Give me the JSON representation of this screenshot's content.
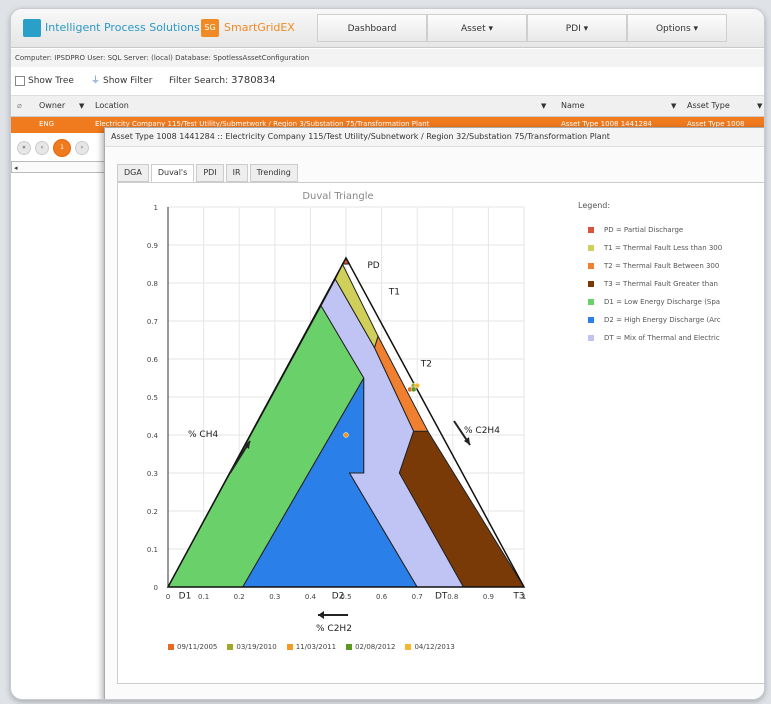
{
  "app": {
    "brand": "Intelligent Process Solutions",
    "product_badge": "SG",
    "product": "SmartGridEX"
  },
  "nav": [
    {
      "label": "Dashboard",
      "w": 110
    },
    {
      "label": "Asset ▾",
      "w": 100
    },
    {
      "label": "PDI ▾",
      "w": 100
    },
    {
      "label": "Options ▾",
      "w": 100
    }
  ],
  "crumb": "Computer: IPSDPRO  User: SQL  Server: (local)  Database: SpotlessAssetConfiguration",
  "toolbar": {
    "show_tree": "Show Tree",
    "show_filter": "Show Filter",
    "filter_search_label": "Filter Search:",
    "filter_search_value": "3780834"
  },
  "grid": {
    "columns": [
      "Owner",
      "Location",
      "Name",
      "Asset Type"
    ],
    "selected_row": [
      "ENG",
      "Electricity Company 115/Test Utility/Submetwork / Region 3/Substation 75/Transformation Plant",
      "Asset Type 1008 1441284",
      "Asset Type 1008"
    ]
  },
  "pager": {
    "current": "1"
  },
  "dialog": {
    "title": "Asset Type 1008 1441284 :: Electricity Company 115/Test Utility/Subnetwork / Region 32/Substation 75/Transformation Plant",
    "tabs": [
      "DGA",
      "Duval's",
      "PDI",
      "IR",
      "Trending"
    ],
    "active_tab": "Duval's"
  },
  "chart_data": {
    "type": "scatter",
    "title": "Duval Triangle",
    "yticks": [
      "0",
      "0.1",
      "0.2",
      "0.3",
      "0.4",
      "0.5",
      "0.6",
      "0.7",
      "0.8",
      "0.9",
      "1"
    ],
    "xticks": [
      "0",
      "0.1",
      "0.2",
      "0.3",
      "0.4",
      "0.5",
      "0.6",
      "0.7",
      "0.8",
      "0.9",
      "1"
    ],
    "zone_labels": [
      "PD",
      "T1",
      "T2",
      "D1",
      "D2",
      "DT",
      "T3"
    ],
    "axis_labels": {
      "left": "% CH4",
      "right": "% C2H4",
      "bottom": "% C2H2"
    },
    "legend_title": "Legend:",
    "legend": [
      {
        "label": "PD = Partial Discharge",
        "color": "#d9533d"
      },
      {
        "label": "T1 = Thermal Fault Less than 300",
        "color": "#cfcf5a"
      },
      {
        "label": "T2 = Thermal Fault Between 300",
        "color": "#f08030"
      },
      {
        "label": "T3 = Thermal Fault Greater than",
        "color": "#7a3a08"
      },
      {
        "label": "D1 = Low Energy Discharge (Spa",
        "color": "#6ad06a"
      },
      {
        "label": "D2 = High Energy Discharge (Arc",
        "color": "#2a7fe8"
      },
      {
        "label": "DT = Mix of Thermal and Electric",
        "color": "#c0c4f4"
      }
    ],
    "samples": [
      {
        "date": "09/11/2005",
        "color": "#e86a20",
        "x": 0.68,
        "y": 0.52
      },
      {
        "date": "03/19/2010",
        "color": "#a0a828",
        "x": 0.69,
        "y": 0.53
      },
      {
        "date": "11/03/2011",
        "color": "#f49a20",
        "x": 0.5,
        "y": 0.4
      },
      {
        "date": "02/08/2012",
        "color": "#5a9a20",
        "x": 0.69,
        "y": 0.52
      },
      {
        "date": "04/12/2013",
        "color": "#f5b630",
        "x": 0.7,
        "y": 0.53
      }
    ],
    "xlim": [
      0,
      1
    ],
    "ylim": [
      0,
      1
    ]
  }
}
